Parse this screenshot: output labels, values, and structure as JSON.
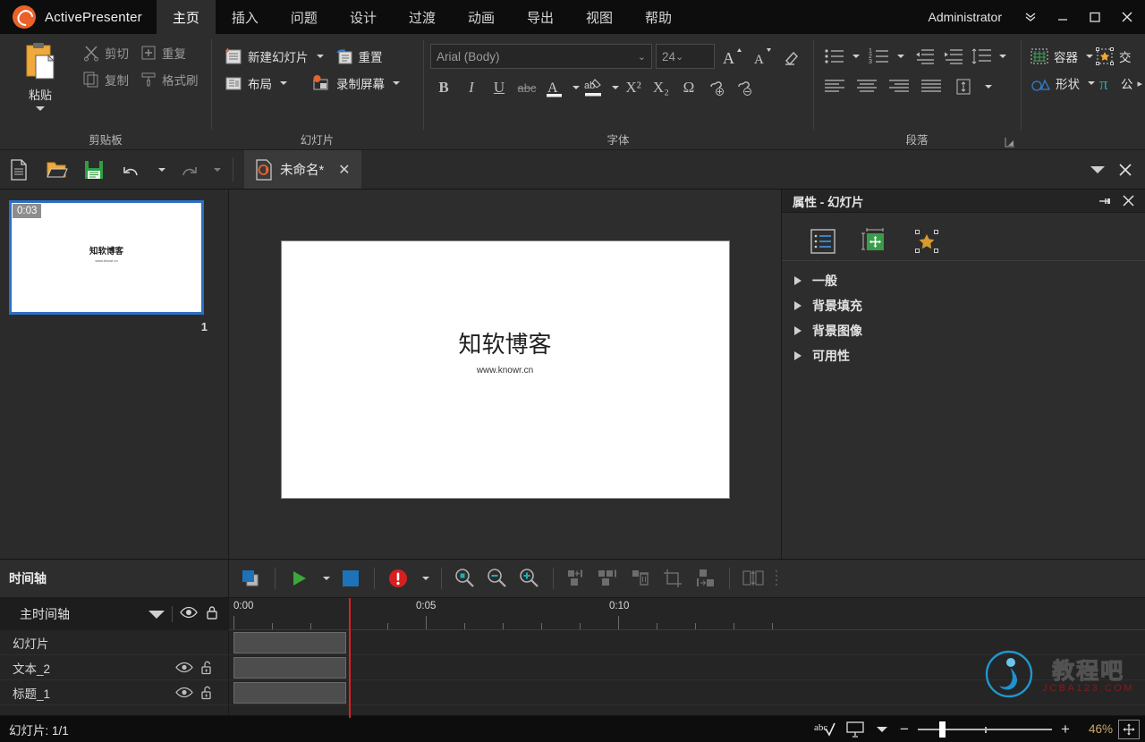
{
  "titlebar": {
    "app_name": "ActivePresenter",
    "tabs": [
      {
        "label": "主页",
        "active": true
      },
      {
        "label": "插入",
        "active": false
      },
      {
        "label": "问题",
        "active": false
      },
      {
        "label": "设计",
        "active": false
      },
      {
        "label": "过渡",
        "active": false
      },
      {
        "label": "动画",
        "active": false
      },
      {
        "label": "导出",
        "active": false
      },
      {
        "label": "视图",
        "active": false
      },
      {
        "label": "帮助",
        "active": false
      }
    ],
    "user": "Administrator",
    "minimize": "—",
    "maximize": "▢",
    "close": "✕"
  },
  "ribbon": {
    "clipboard": {
      "group_label": "剪贴板",
      "paste": "粘贴",
      "cut": "剪切",
      "duplicate": "重复",
      "copy": "复制",
      "format_painter": "格式刷"
    },
    "slide": {
      "group_label": "幻灯片",
      "new_slide": "新建幻灯片",
      "reset": "重置",
      "layout": "布局",
      "record_screen": "录制屏幕"
    },
    "font": {
      "group_label": "字体",
      "font_name": "Arial (Body)",
      "font_size": "24",
      "grow": "A",
      "shrink": "A",
      "clear_format": "clear",
      "bold": "B",
      "italic": "I",
      "underline": "U",
      "strikethrough": "abc",
      "font_color": "A",
      "highlight": "ab",
      "superscript": "X²",
      "subscript": "X₂",
      "symbol": "Ω",
      "add_link": "link+",
      "remove_link": "link-"
    },
    "paragraph": {
      "group_label": "段落"
    },
    "insert": {
      "container": "容器",
      "interaction": "交",
      "shape": "形状",
      "formula": "公"
    }
  },
  "doctoolbar": {
    "new_label": "new-document",
    "open_label": "open-document",
    "save_label": "save-document",
    "undo_label": "undo",
    "redo_label": "redo",
    "tab_title": "未命名*",
    "tab_close": "✕"
  },
  "slides": {
    "thumbnails": [
      {
        "number": "1",
        "duration": "0:03",
        "title": "知软博客",
        "subtitle": "www.knowr.cn",
        "selected": true
      }
    ]
  },
  "canvas": {
    "title": "知软博客",
    "subtitle": "www.knowr.cn"
  },
  "properties": {
    "header": "属性 - 幻灯片",
    "tabs": [
      {
        "name": "slide-properties",
        "active": true
      },
      {
        "name": "size-position",
        "active": false
      },
      {
        "name": "interactivity",
        "active": false
      }
    ],
    "sections": [
      {
        "label": "一般",
        "expanded": false
      },
      {
        "label": "背景填充",
        "expanded": false
      },
      {
        "label": "背景图像",
        "expanded": false
      },
      {
        "label": "可用性",
        "expanded": false
      }
    ]
  },
  "timeline": {
    "panel_title": "时间轴",
    "track_group": "主时间轴",
    "ruler_labels": [
      "0:00",
      "0:05",
      "0:10"
    ],
    "tracks": [
      {
        "name": "幻灯片",
        "has_controls": false,
        "bar_start": 0,
        "bar_end": 3.03
      },
      {
        "name": "文本_2",
        "has_controls": true,
        "bar_start": 0,
        "bar_end": 3.03
      },
      {
        "name": "标题_1",
        "has_controls": true,
        "bar_start": 0,
        "bar_end": 3.03
      }
    ],
    "playhead_time": "0:03"
  },
  "status": {
    "slide_counter": "幻灯片: 1/1",
    "spellcheck": "abc",
    "zoom_percent": "46%",
    "zoom_minus": "−",
    "zoom_plus": "+"
  },
  "watermark": {
    "cn": "教程吧",
    "en": "JCBA123.COM"
  },
  "colors": {
    "accent_orange": "#e8622a",
    "selection_blue": "#2b6fc4",
    "playhead_red": "#e02020",
    "zoom_gold": "#c8a96a",
    "titlebar_bg": "#0d0d0d",
    "ribbon_bg": "#2d2d2d"
  }
}
